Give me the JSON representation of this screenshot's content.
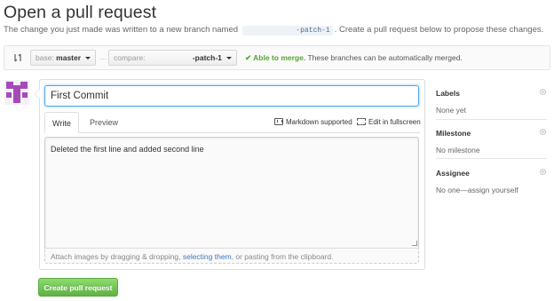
{
  "page": {
    "title": "Open a pull request",
    "subtitle_before": "The change you just made was written to a new branch named",
    "branch_redacted": "xxxxxxxxxxxx",
    "branch_suffix": "-patch-1",
    "subtitle_after": ". Create a pull request below to propose these changes."
  },
  "compare_bar": {
    "base_prefix": "base:",
    "base_branch": "master",
    "separator": "...",
    "compare_prefix": "compare:",
    "compare_redacted": "xxxxxxxxxxxx",
    "compare_branch": "-patch-1",
    "merge_ok": "✔ Able to merge.",
    "merge_text": "These branches can be automatically merged.",
    "ok_color": "#55a532"
  },
  "form": {
    "title_value": "First Commit",
    "tab_write": "Write",
    "tab_preview": "Preview",
    "markdown_label": "Markdown supported",
    "fullscreen_label": "Edit in fullscreen",
    "body_value": "Deleted the first line and added second line",
    "attach_before": "Attach images by dragging & dropping, ",
    "attach_link": "selecting them",
    "attach_after": ", or pasting from the clipboard."
  },
  "actions": {
    "create_label": "Create pull request",
    "button_color": "#60b044"
  },
  "sidebar": {
    "labels_header": "Labels",
    "labels_value": "None yet",
    "milestone_header": "Milestone",
    "milestone_value": "No milestone",
    "assignee_header": "Assignee",
    "assignee_value": "No one—assign yourself"
  }
}
